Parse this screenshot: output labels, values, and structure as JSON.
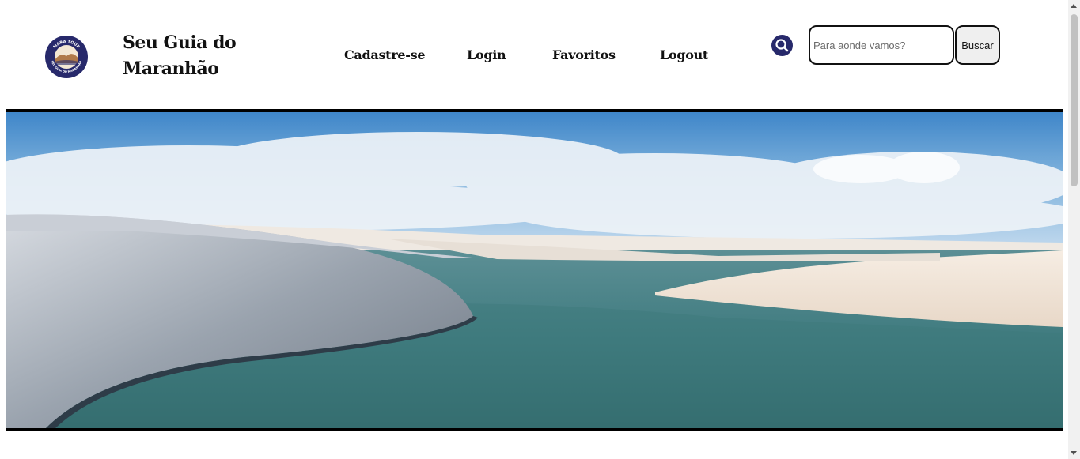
{
  "brand": {
    "title": "Seu Guia do Maranhão",
    "logo_text_top": "MARA TOUR",
    "logo_text_bottom": "SEU GUIA DO MARANHÃO"
  },
  "nav": {
    "items": [
      {
        "label": "Cadastre-se"
      },
      {
        "label": "Login"
      },
      {
        "label": "Favoritos"
      },
      {
        "label": "Logout"
      }
    ]
  },
  "search": {
    "icon": "search-icon",
    "placeholder": "Para aonde vamos?",
    "value": "",
    "button_label": "Buscar"
  },
  "colors": {
    "accent": "#27296b",
    "text": "#111111",
    "button_bg": "#efefef"
  },
  "hero": {
    "image": "lencois-maranhenses-dunes-lagoon"
  }
}
